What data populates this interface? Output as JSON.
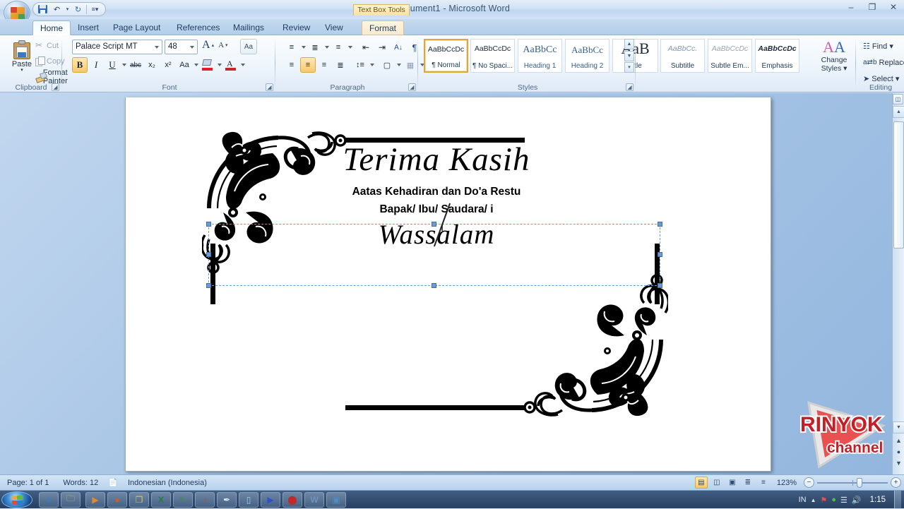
{
  "window": {
    "title": "Document1 - Microsoft Word",
    "contextual_tools": "Text Box Tools",
    "minimize": "–",
    "maximize": "❐",
    "close": "✕"
  },
  "quick_access": {
    "save_icon": "save-icon",
    "undo_icon": "undo-icon",
    "redo_icon": "redo-icon",
    "customize_icon": "chevron-down-icon"
  },
  "tabs": [
    {
      "label": "Home",
      "active": true
    },
    {
      "label": "Insert",
      "active": false
    },
    {
      "label": "Page Layout",
      "active": false
    },
    {
      "label": "References",
      "active": false
    },
    {
      "label": "Mailings",
      "active": false
    },
    {
      "label": "Review",
      "active": false
    },
    {
      "label": "View",
      "active": false
    },
    {
      "label": "Format",
      "active": false,
      "contextual": true
    }
  ],
  "ribbon": {
    "clipboard": {
      "label": "Clipboard",
      "paste": "Paste",
      "paste_arrow": "▾",
      "cut": "Cut",
      "copy": "Copy",
      "format_painter": "Format Painter"
    },
    "font": {
      "label": "Font",
      "font_name": "Palace Script MT",
      "font_size": "48",
      "grow_font": "A",
      "shrink_font": "A",
      "clear_formatting": "Aa",
      "bold": "B",
      "italic": "I",
      "underline": "U",
      "strikethrough": "abc",
      "subscript": "x₂",
      "superscript": "x²",
      "change_case": "Aa",
      "text_highlight": "highlight-icon",
      "font_color": "font-color-icon",
      "bold_active": true
    },
    "paragraph": {
      "label": "Paragraph",
      "bullets": "bullets-icon",
      "numbering": "numbering-icon",
      "multilevel": "multilevel-list-icon",
      "decrease_indent": "decrease-indent-icon",
      "increase_indent": "increase-indent-icon",
      "sort": "sort-icon",
      "show_marks": "¶",
      "align_left": "align-left-icon",
      "align_center": "align-center-icon",
      "align_right": "align-right-icon",
      "justify": "justify-icon",
      "line_spacing": "line-spacing-icon",
      "shading": "shading-icon",
      "borders": "borders-icon",
      "align_center_active": true
    },
    "styles": {
      "label": "Styles",
      "items": [
        {
          "sample": "AaBbCcDc",
          "name": "¶ Normal",
          "selected": true
        },
        {
          "sample": "AaBbCcDc",
          "name": "¶ No Spaci...",
          "selected": false
        },
        {
          "sample": "AaBbCс",
          "name": "Heading 1",
          "selected": false
        },
        {
          "sample": "AaBbCc",
          "name": "Heading 2",
          "selected": false
        },
        {
          "sample": "AaB",
          "name": "Title",
          "selected": false
        },
        {
          "sample": "AaBbCc.",
          "name": "Subtitle",
          "selected": false
        },
        {
          "sample": "AaBbCcDc",
          "name": "Subtle Em...",
          "selected": false
        },
        {
          "sample": "AaBbCcDc",
          "name": "Emphasis",
          "selected": false
        }
      ],
      "scroll_up": "▲",
      "scroll_down": "▼",
      "more": "▾"
    },
    "change_styles": {
      "line1": "Change",
      "line2": "Styles ▾"
    },
    "editing": {
      "label": "Editing",
      "find": "Find ▾",
      "replace": "Replace",
      "select": "Select ▾"
    }
  },
  "document": {
    "lines": {
      "title": "Terima Kasih",
      "line2": "Aatas Kehadiran dan Do'a  Restu",
      "line3": "Bapak/ Ibu/ Saudara/ i",
      "signature": "Wassalam"
    },
    "ornament_name": "ornamental-border-frame"
  },
  "status_bar": {
    "page": "Page: 1 of 1",
    "words": "Words: 12",
    "proofing_icon": "proofing-errors-icon",
    "language": "Indonesian (Indonesia)",
    "views": [
      {
        "name": "print-layout-view",
        "glyph": "▤",
        "active": true
      },
      {
        "name": "full-screen-reading-view",
        "glyph": "◫",
        "active": false
      },
      {
        "name": "web-layout-view",
        "glyph": "▣",
        "active": false
      },
      {
        "name": "outline-view",
        "glyph": "≣",
        "active": false
      },
      {
        "name": "draft-view",
        "glyph": "≡",
        "active": false
      }
    ],
    "zoom": "123%",
    "zoom_out": "−",
    "zoom_in": "+"
  },
  "taskbar": {
    "start": "start-orb",
    "items": [
      {
        "name": "internet-explorer-icon",
        "glyph": "e",
        "color": "#2f7fd1"
      },
      {
        "name": "windows-explorer-icon",
        "glyph": "🗀",
        "color": "#e8b54d"
      },
      {
        "name": "media-player-icon",
        "glyph": "▶",
        "color": "#e8862a"
      },
      {
        "name": "firefox-icon",
        "glyph": "●",
        "color": "#d85a20"
      },
      {
        "name": "folder-apps-icon",
        "glyph": "❐",
        "color": "#e0c24a"
      },
      {
        "name": "excel-icon",
        "glyph": "X",
        "color": "#1f7a44"
      },
      {
        "name": "paint-icon",
        "glyph": "✎",
        "color": "#3b8c4a"
      },
      {
        "name": "music-note-icon",
        "glyph": "♪",
        "color": "#c14a2a"
      },
      {
        "name": "pen-tool-icon",
        "glyph": "✒",
        "color": "#5a5a5a"
      },
      {
        "name": "notepad-icon",
        "glyph": "▯",
        "color": "#6fa8c8"
      },
      {
        "name": "corel-icon",
        "glyph": "▶",
        "color": "#2f4fd1"
      },
      {
        "name": "photo-app-icon",
        "glyph": "⬤",
        "color": "#c12a2a"
      },
      {
        "name": "word-document-icon",
        "glyph": "W",
        "color": "#2f6cb5"
      },
      {
        "name": "image-viewer-icon",
        "glyph": "▣",
        "color": "#4d8fc0"
      }
    ],
    "tray": {
      "language": "IN",
      "show_hidden": "▲",
      "network_icon": "network-error-icon",
      "security_icon": "security-shield-icon",
      "signal_icon": "signal-bars-icon",
      "volume_icon": "volume-icon",
      "clock": "1:15"
    }
  },
  "watermark": {
    "line1": "RINYOK",
    "line2": "channel",
    "color": "#c12026"
  },
  "colors": {
    "accent_orange": "#f8c86a",
    "ribbon_blue": "#cfe1f4",
    "desktop_blue": "#a9c6e6",
    "selection_blue": "#6a9bd3"
  }
}
